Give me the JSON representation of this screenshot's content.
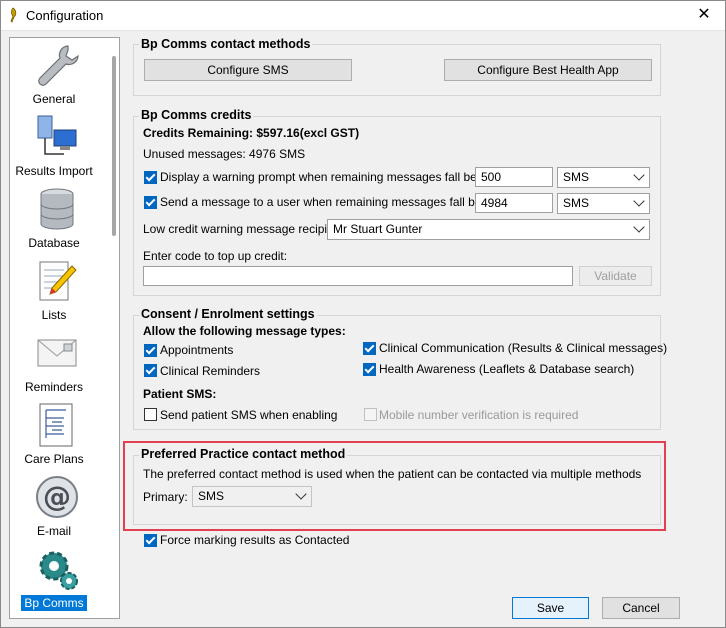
{
  "window": {
    "title": "Configuration",
    "close_glyph": "✕"
  },
  "sidebar": {
    "items": [
      {
        "label": "General",
        "icon": "wrench-icon"
      },
      {
        "label": "Results Import",
        "icon": "computer-network-icon"
      },
      {
        "label": "Database",
        "icon": "database-icon"
      },
      {
        "label": "Lists",
        "icon": "notepad-pencil-icon"
      },
      {
        "label": "Reminders",
        "icon": "envelope-icon"
      },
      {
        "label": "Care Plans",
        "icon": "document-tree-icon"
      },
      {
        "label": "E-mail",
        "icon": "at-sign-icon"
      },
      {
        "label": "Bp Comms",
        "icon": "gears-icon",
        "active": true
      }
    ]
  },
  "contact_methods": {
    "title": "Bp Comms contact methods",
    "configure_sms": "Configure SMS",
    "configure_app": "Configure Best Health App"
  },
  "credits": {
    "title": "Bp Comms credits",
    "remaining": "Credits Remaining: $597.16(excl GST)",
    "unused": "Unused messages: 4976 SMS",
    "warning_label": "Display a warning prompt when remaining messages fall below:",
    "warning_value": "500",
    "warning_unit": "SMS",
    "send_label": "Send a message to a user when remaining messages fall below:",
    "send_value": "4984",
    "send_unit": "SMS",
    "recipient_label": "Low credit warning message recipient:",
    "recipient_value": "Mr Stuart Gunter",
    "code_label": "Enter code to top up credit:",
    "code_value": "",
    "validate": "Validate"
  },
  "consent": {
    "title": "Consent / Enrolment settings",
    "allow_heading": "Allow the following message types:",
    "appointments": "Appointments",
    "clinical_reminders": "Clinical Reminders",
    "clinical_communication": "Clinical Communication (Results & Clinical messages)",
    "health_awareness": "Health Awareness (Leaflets & Database search)",
    "patient_sms_heading": "Patient SMS:",
    "send_patient_sms": "Send patient SMS when enabling",
    "mobile_verification": "Mobile number verification is required"
  },
  "preferred": {
    "title": "Preferred Practice contact method",
    "description": "The preferred contact method is used when the patient can be contacted via multiple methods",
    "primary_label": "Primary:",
    "primary_value": "SMS"
  },
  "force_marking": "Force marking results as Contacted",
  "footer": {
    "save": "Save",
    "cancel": "Cancel"
  },
  "colors": {
    "accent": "#0078d7",
    "highlight": "#e04050"
  }
}
